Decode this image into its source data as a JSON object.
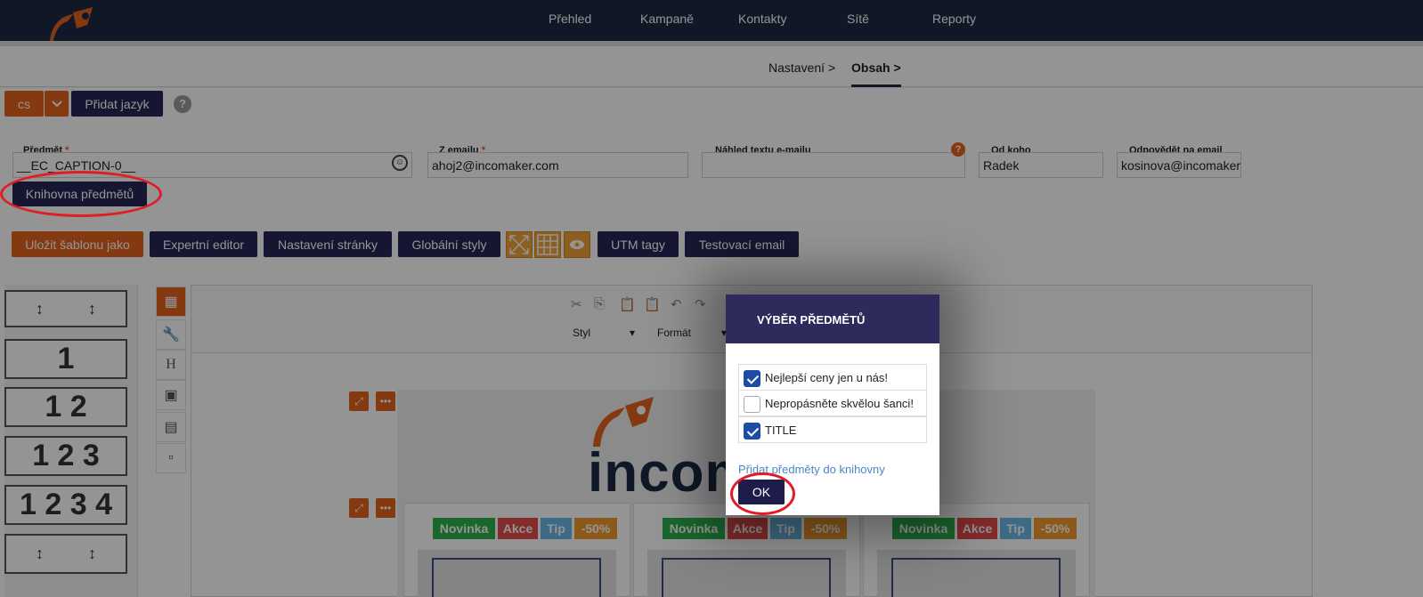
{
  "nav": {
    "items": [
      "Přehled",
      "Kampaně",
      "Kontakty",
      "Sítě",
      "Reporty"
    ]
  },
  "breadcrumb": {
    "step1": "Nastavení",
    "step2": "Obsah",
    "sep": ">"
  },
  "lang": {
    "current": "cs",
    "add_label": "Přidat jazyk",
    "help": "?"
  },
  "fields": {
    "subject": {
      "label": "Předmět",
      "value": "__EC_CAPTION-0__",
      "req": "*"
    },
    "from_email": {
      "label": "Z emailu",
      "value": "ahoj2@incomaker.com",
      "req": "*"
    },
    "preview": {
      "label": "Náhled textu e-mailu",
      "value": ""
    },
    "from_name": {
      "label": "Od koho",
      "value": "Radek"
    },
    "reply_to": {
      "label": "Odpovědět na email",
      "value": "kosinova@incomaker"
    }
  },
  "library_button": "Knihovna předmětů",
  "toolbar": {
    "save_template": "Uložit šablonu jako",
    "expert": "Expertní editor",
    "page_settings": "Nastavení stránky",
    "global_styles": "Globální styly",
    "utm": "UTM tagy",
    "test_email": "Testovací email"
  },
  "editor": {
    "style": "Styl",
    "format": "Formát"
  },
  "blocks": [
    "1",
    "1 2",
    "1 2 3",
    "1 2 3 4"
  ],
  "canvas": {
    "brand_text": "incom",
    "tags": [
      "Novinka",
      "Akce",
      "Tip",
      "-50%"
    ]
  },
  "modal": {
    "title": "VÝBĚR PŘEDMĚTŮ",
    "items": [
      {
        "label": "Nejlepší ceny jen u nás!",
        "checked": true
      },
      {
        "label": "Nepropásněte skvělou šanci!",
        "checked": false
      },
      {
        "label": "TITLE",
        "checked": true
      }
    ],
    "add_link": "Přidat předměty do knihovny",
    "ok": "OK"
  },
  "colors": {
    "navy": "#1d2a44",
    "orange": "#e3621e",
    "modal_header": "#2c2b5c"
  }
}
